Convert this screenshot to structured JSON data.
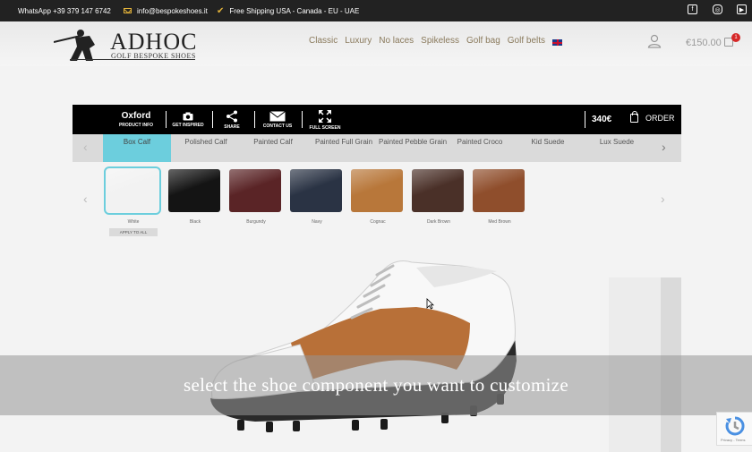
{
  "topbar": {
    "whatsapp": "WhatsApp +39 379 147 6742",
    "email": "info@bespokeshoes.it",
    "shipping": "Free Shipping USA - Canada - EU - UAE",
    "social_icons": [
      "facebook-icon",
      "instagram-icon",
      "youtube-icon"
    ]
  },
  "header": {
    "logo_word": "ADHOC",
    "logo_sub": "GOLF BESPOKE SHOES",
    "nav": [
      "Classic",
      "Luxury",
      "No laces",
      "Spikeless",
      "Golf bag",
      "Golf belts"
    ],
    "price": "€150.00",
    "cart_count": "1"
  },
  "toolbar": {
    "model": "Oxford",
    "product_info": "PRODUCT INFO",
    "get_inspired": "GET INSPIRED",
    "share": "SHARE",
    "contact": "CONTACT US",
    "fullscreen": "FULL SCREEN",
    "price": "340€",
    "order": "ORDER"
  },
  "leathers": {
    "active_index": 0,
    "tabs": [
      "Box Calf",
      "Polished Calf",
      "Painted Calf",
      "Painted Full Grain",
      "Painted Pebble Grain",
      "Painted Croco",
      "Kid Suede",
      "Lux Suede"
    ]
  },
  "swatches": {
    "selected_index": 0,
    "items": [
      {
        "label": "White",
        "color": "#f2f2f2"
      },
      {
        "label": "Black",
        "color": "#141414"
      },
      {
        "label": "Burgundy",
        "color": "#5a2426"
      },
      {
        "label": "Navy",
        "color": "#2a3344"
      },
      {
        "label": "Cognac",
        "color": "#b8773a"
      },
      {
        "label": "Dark Brown",
        "color": "#4a3028"
      },
      {
        "label": "Med Brown",
        "color": "#8f4e2c"
      }
    ],
    "apply_label": "APPLY TO ALL"
  },
  "overlay_text": "select the shoe component you want to customize",
  "recaptcha_text": "Privacy - Terms",
  "colors": {
    "accent": "#6ccedd",
    "toolbar_bg": "#000000",
    "badge": "#d62828",
    "nav_text": "#8a7a5c"
  }
}
